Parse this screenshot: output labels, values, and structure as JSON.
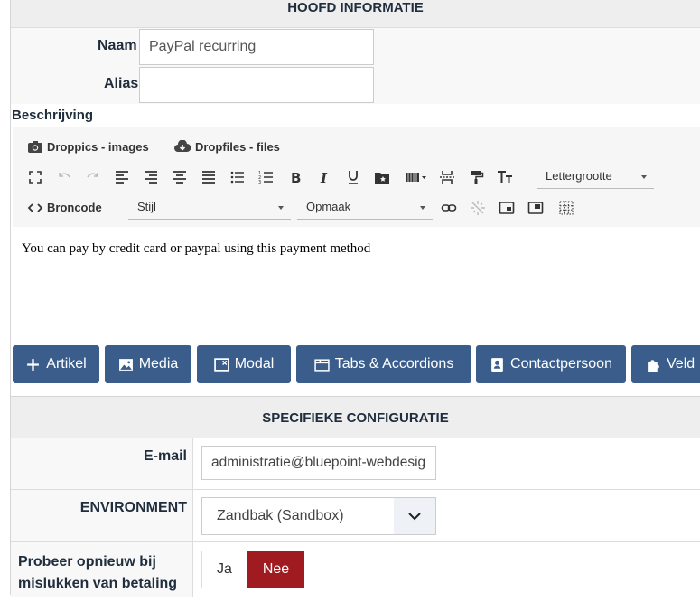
{
  "section1": {
    "title": "HOOFD INFORMATIE"
  },
  "form": {
    "name_label": "Naam",
    "name_value": "PayPal recurring",
    "alias_label": "Alias",
    "alias_value": ""
  },
  "description": {
    "label": "Beschrijving",
    "plugins": {
      "droppics": "Droppics - images",
      "dropfiles": "Dropfiles - files"
    },
    "toolbar": {
      "font_size_placeholder": "Lettergrootte",
      "source_label": "Broncode",
      "style_placeholder": "Stijl",
      "format_placeholder": "Opmaak"
    },
    "content": "You can pay by credit card or paypal using this payment method"
  },
  "buttons": {
    "artikel": "Artikel",
    "media": "Media",
    "modal": "Modal",
    "tabs": "Tabs & Accordions",
    "contact": "Contactpersoon",
    "veld": "Veld"
  },
  "section2": {
    "title": "SPECIFIEKE CONFIGURATIE",
    "email_label": "E-mail",
    "email_value": "administratie@bluepoint-webdesign.nl",
    "env_label": "ENVIRONMENT",
    "env_value": "Zandbak (Sandbox)",
    "retry_label_line1": "Probeer opnieuw bij",
    "retry_label_line2": "mislukken van betaling",
    "yes_label": "Ja",
    "no_label": "Nee"
  },
  "colors": {
    "button_blue": "#3a5d8c",
    "toggle_active_red": "#a01b1f",
    "label_text": "#1f2d3d"
  }
}
